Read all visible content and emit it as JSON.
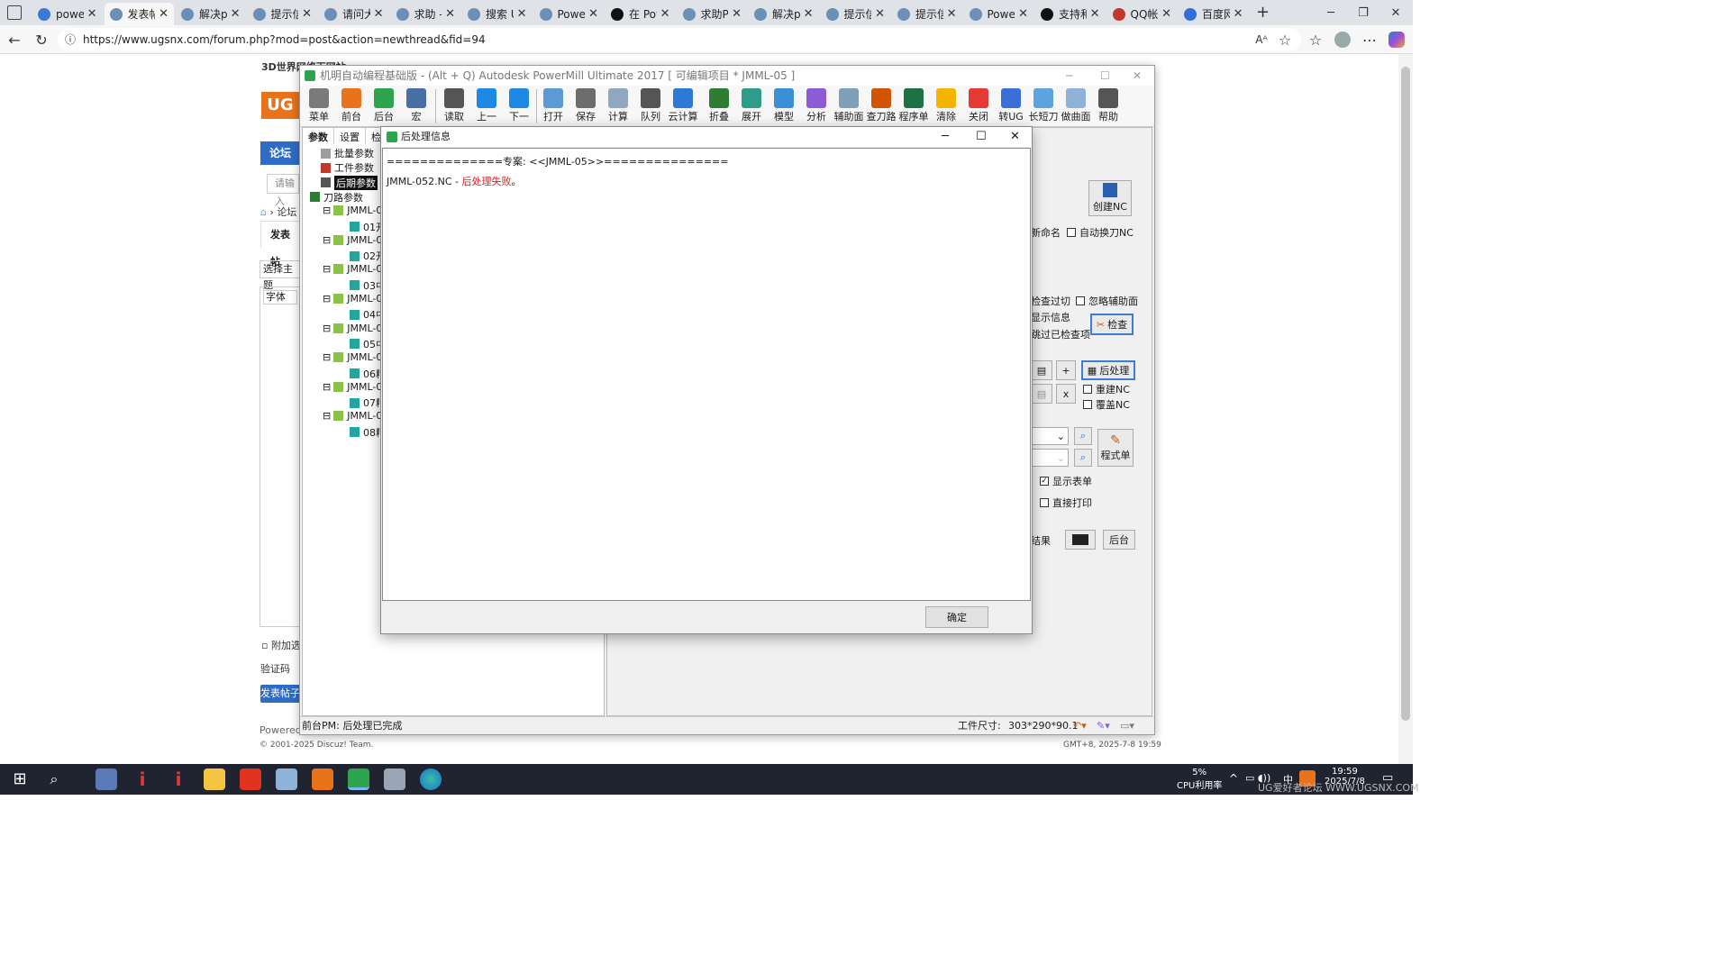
{
  "browser": {
    "tabs": [
      {
        "label": "power",
        "color": "#3a7bd5"
      },
      {
        "label": "发表帖",
        "color": "#6b8fb5",
        "active": true
      },
      {
        "label": "解决pr",
        "color": "#6b8fb5"
      },
      {
        "label": "提示信",
        "color": "#6b8fb5"
      },
      {
        "label": "请问大",
        "color": "#6b8fb5"
      },
      {
        "label": "求助 -",
        "color": "#6b8fb5"
      },
      {
        "label": "搜索 U",
        "color": "#6b8fb5"
      },
      {
        "label": "Power",
        "color": "#6b8fb5"
      },
      {
        "label": "在 Pow",
        "color": "#111111"
      },
      {
        "label": "求助PC",
        "color": "#6b8fb5"
      },
      {
        "label": "解决pr",
        "color": "#6b8fb5"
      },
      {
        "label": "提示信",
        "color": "#6b8fb5"
      },
      {
        "label": "提示信",
        "color": "#6b8fb5"
      },
      {
        "label": "Power",
        "color": "#6b8fb5"
      },
      {
        "label": "支持和",
        "color": "#111111"
      },
      {
        "label": "QQ帐号",
        "color": "#c0392b"
      },
      {
        "label": "百度网",
        "color": "#2f6fd6"
      }
    ],
    "url": "https://www.ugsnx.com/forum.php?mod=post&action=newthread&fid=94"
  },
  "website": {
    "header_text": "3D世界网络下网站",
    "nav_label": "论坛",
    "search_placeholder": "请输入",
    "breadcrumb": "论坛",
    "post_tab": "发表帖",
    "select_theme": "选择主题",
    "font_label": "字体",
    "attach_label": "附加选",
    "captcha_label": "验证码",
    "submit_label": "发表帖子",
    "powered_by": "Powered b",
    "copyright": "© 2001-2025 Discuz! Team.",
    "time_footer": "GMT+8, 2025-7-8 19:59"
  },
  "powermill": {
    "title": "机明自动编程基础版 - (Alt + Q) Autodesk PowerMill Ultimate 2017    [ 可编辑项目 * JMML-05 ]",
    "toolbar": [
      {
        "label": "菜单",
        "icon": "gear-icon",
        "color": "#7a7a7a"
      },
      {
        "label": "前台",
        "icon": "p-doc-icon",
        "color": "#e8731a"
      },
      {
        "label": "后台",
        "icon": "plus-icon",
        "color": "#2ea44f"
      },
      {
        "label": "宏",
        "icon": "macro-icon",
        "color": "#4a6fa5"
      },
      {
        "label": "读取",
        "icon": "sliders-icon",
        "color": "#555555"
      },
      {
        "label": "上一",
        "icon": "prev-icon",
        "color": "#1e88e5"
      },
      {
        "label": "下一",
        "icon": "next-icon",
        "color": "#1e88e5"
      },
      {
        "label": "打开",
        "icon": "folder-icon",
        "color": "#5b9bd5"
      },
      {
        "label": "保存",
        "icon": "save-icon",
        "color": "#6d6d6d"
      },
      {
        "label": "计算",
        "icon": "calculator-icon",
        "color": "#8fa7c0"
      },
      {
        "label": "队列",
        "icon": "queue-icon",
        "color": "#555555"
      },
      {
        "label": "云计算",
        "icon": "cloud-icon",
        "color": "#2b7bd6"
      },
      {
        "label": "折叠",
        "icon": "collapse-icon",
        "color": "#2e7d32"
      },
      {
        "label": "展开",
        "icon": "expand-icon",
        "color": "#2e9c8a"
      },
      {
        "label": "模型",
        "icon": "cube-icon",
        "color": "#3b8fd8"
      },
      {
        "label": "分析",
        "icon": "analyze-icon",
        "color": "#8e5bd6"
      },
      {
        "label": "辅助面",
        "icon": "surface-icon",
        "color": "#7fa0b8"
      },
      {
        "label": "查刀路",
        "icon": "tools-icon",
        "color": "#d35400"
      },
      {
        "label": "程序单",
        "icon": "excel-icon",
        "color": "#1e7145"
      },
      {
        "label": "清除",
        "icon": "warning-icon",
        "color": "#f5b400"
      },
      {
        "label": "关闭",
        "icon": "close-circle-icon",
        "color": "#e53935"
      },
      {
        "label": "转UG",
        "icon": "ug-icon",
        "color": "#3a6fd8"
      },
      {
        "label": "长短刀",
        "icon": "ruler-icon",
        "color": "#5ba4e0"
      },
      {
        "label": "做曲面",
        "icon": "curved-surface-icon",
        "color": "#8fb2d8"
      },
      {
        "label": "帮助",
        "icon": "help-icon",
        "color": "#555555"
      }
    ],
    "panel_tabs": [
      "参数",
      "设置",
      "检"
    ],
    "tree": [
      {
        "label": "批量参数",
        "icon": "#9e9e9e"
      },
      {
        "label": "工件参数",
        "icon": "#c0392b"
      },
      {
        "label": "后期参数",
        "icon": "#555555",
        "selected": true
      },
      {
        "label": "刀路参数",
        "icon": "#2e7d32"
      }
    ],
    "toolpaths": [
      {
        "group": "JMML-0",
        "child": "01开"
      },
      {
        "group": "JMML-0",
        "child": "02开"
      },
      {
        "group": "JMML-0",
        "child": "03中"
      },
      {
        "group": "JMML-0",
        "child": "04中"
      },
      {
        "group": "JMML-0",
        "child": "05中"
      },
      {
        "group": "JMML-0",
        "child": "06精"
      },
      {
        "group": "JMML-0",
        "child": "07精"
      },
      {
        "group": "JMML-0",
        "child": "08精"
      }
    ],
    "right": {
      "create_nc": "创建NC",
      "rename": "新命名",
      "auto_tool_change": "自动换刀NC",
      "check_overcut": "检查过切",
      "ignore_aux": "忽略辅助面",
      "show_info": "显示信息",
      "skip_checked": "跳过已检查项",
      "check_btn": "检查",
      "post_btn": "后处理",
      "plus": "+",
      "times": "x",
      "rebuild_nc": "重建NC",
      "overwrite_nc": "覆盖NC",
      "program_sheet": "程式单",
      "show_sheet": "显示表单",
      "direct_print": "直接打印",
      "result": "结果",
      "background": "后台"
    },
    "status_left": "前台PM: 后处理已完成",
    "workpiece_label": "工件尺寸:",
    "workpiece_size": "303*290*90.1"
  },
  "dialog": {
    "title": "后处理信息",
    "line1": "==============专案: <<JMML-05>>===============",
    "line2_file": "JMML-052.NC - ",
    "line2_status": "后处理失败",
    "line2_end": "。",
    "ok": "确定"
  },
  "taskbar": {
    "cpu_percent": "5%",
    "cpu_label": "CPU利用率",
    "time": "19:59",
    "date": "2025/7/8",
    "ime": "中",
    "watermark": "UG爱好者论坛 WWW.UGSNX.COM"
  }
}
